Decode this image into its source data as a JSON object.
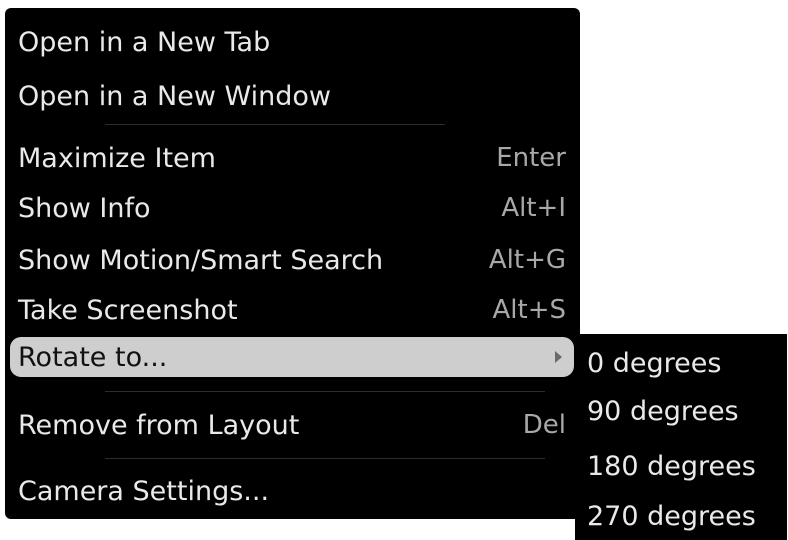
{
  "context_menu": {
    "items": [
      {
        "label": "Open in a New Tab",
        "shortcut": ""
      },
      {
        "label": "Open in a New Window",
        "shortcut": ""
      },
      {
        "label": "Maximize Item",
        "shortcut": "Enter"
      },
      {
        "label": "Show Info",
        "shortcut": "Alt+I"
      },
      {
        "label": "Show Motion/Smart Search",
        "shortcut": "Alt+G"
      },
      {
        "label": "Take Screenshot",
        "shortcut": "Alt+S"
      },
      {
        "label": "Rotate to...",
        "shortcut": ""
      },
      {
        "label": "Remove from Layout",
        "shortcut": "Del"
      },
      {
        "label": "Camera Settings...",
        "shortcut": ""
      }
    ]
  },
  "rotate_submenu": {
    "items": [
      {
        "label": "0 degrees"
      },
      {
        "label": "90 degrees"
      },
      {
        "label": "180 degrees"
      },
      {
        "label": "270 degrees"
      }
    ]
  },
  "colors": {
    "menu_background": "#000000",
    "text": "#e9e9e9",
    "shortcut_text": "#a8a8a8",
    "highlight": "#cecece"
  },
  "icons": {
    "submenu_arrow": "chevron-right-icon"
  }
}
